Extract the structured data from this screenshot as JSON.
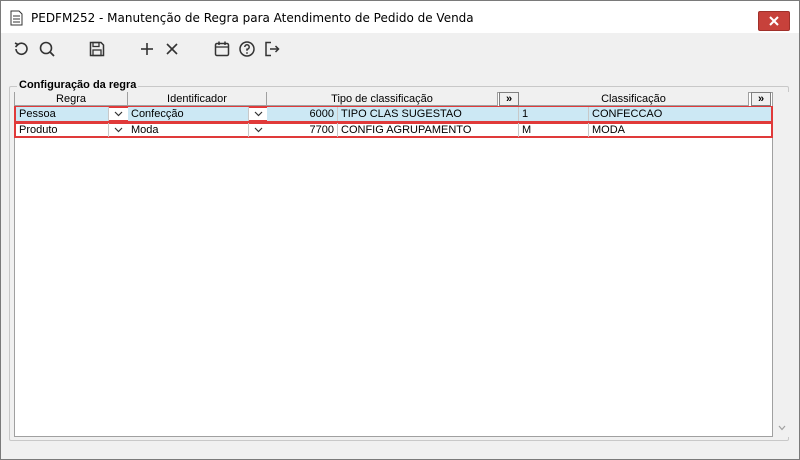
{
  "window": {
    "title": "PEDFM252 - Manutenção de Regra para Atendimento de Pedido de Venda"
  },
  "toolbar": {
    "buttons": [
      "refresh-icon",
      "search-icon",
      "save-icon",
      "add-icon",
      "remove-icon",
      "calendar-icon",
      "help-icon",
      "exit-icon"
    ]
  },
  "group": {
    "title": "Configuração da regra"
  },
  "grid": {
    "columns": {
      "regra": "Regra",
      "identificador": "Identificador",
      "tipo": "Tipo de classificação",
      "more1": "»",
      "classificacao": "Classificação",
      "more2": "»"
    },
    "rows": [
      {
        "regra": "Pessoa",
        "identificador": "Confecção",
        "tipo_codigo": "6000",
        "tipo_descricao": "TIPO CLAS SUGESTAO",
        "class_codigo": "1",
        "class_descricao": "CONFECCAO"
      },
      {
        "regra": "Produto",
        "identificador": "Moda",
        "tipo_codigo": "7700",
        "tipo_descricao": "CONFIG AGRUPAMENTO",
        "class_codigo": "M",
        "class_descricao": "MODA"
      }
    ]
  },
  "colors": {
    "selected_cell": "#cce8f4",
    "row_highlight": "#e03a3a",
    "close_button": "#c7413b"
  }
}
